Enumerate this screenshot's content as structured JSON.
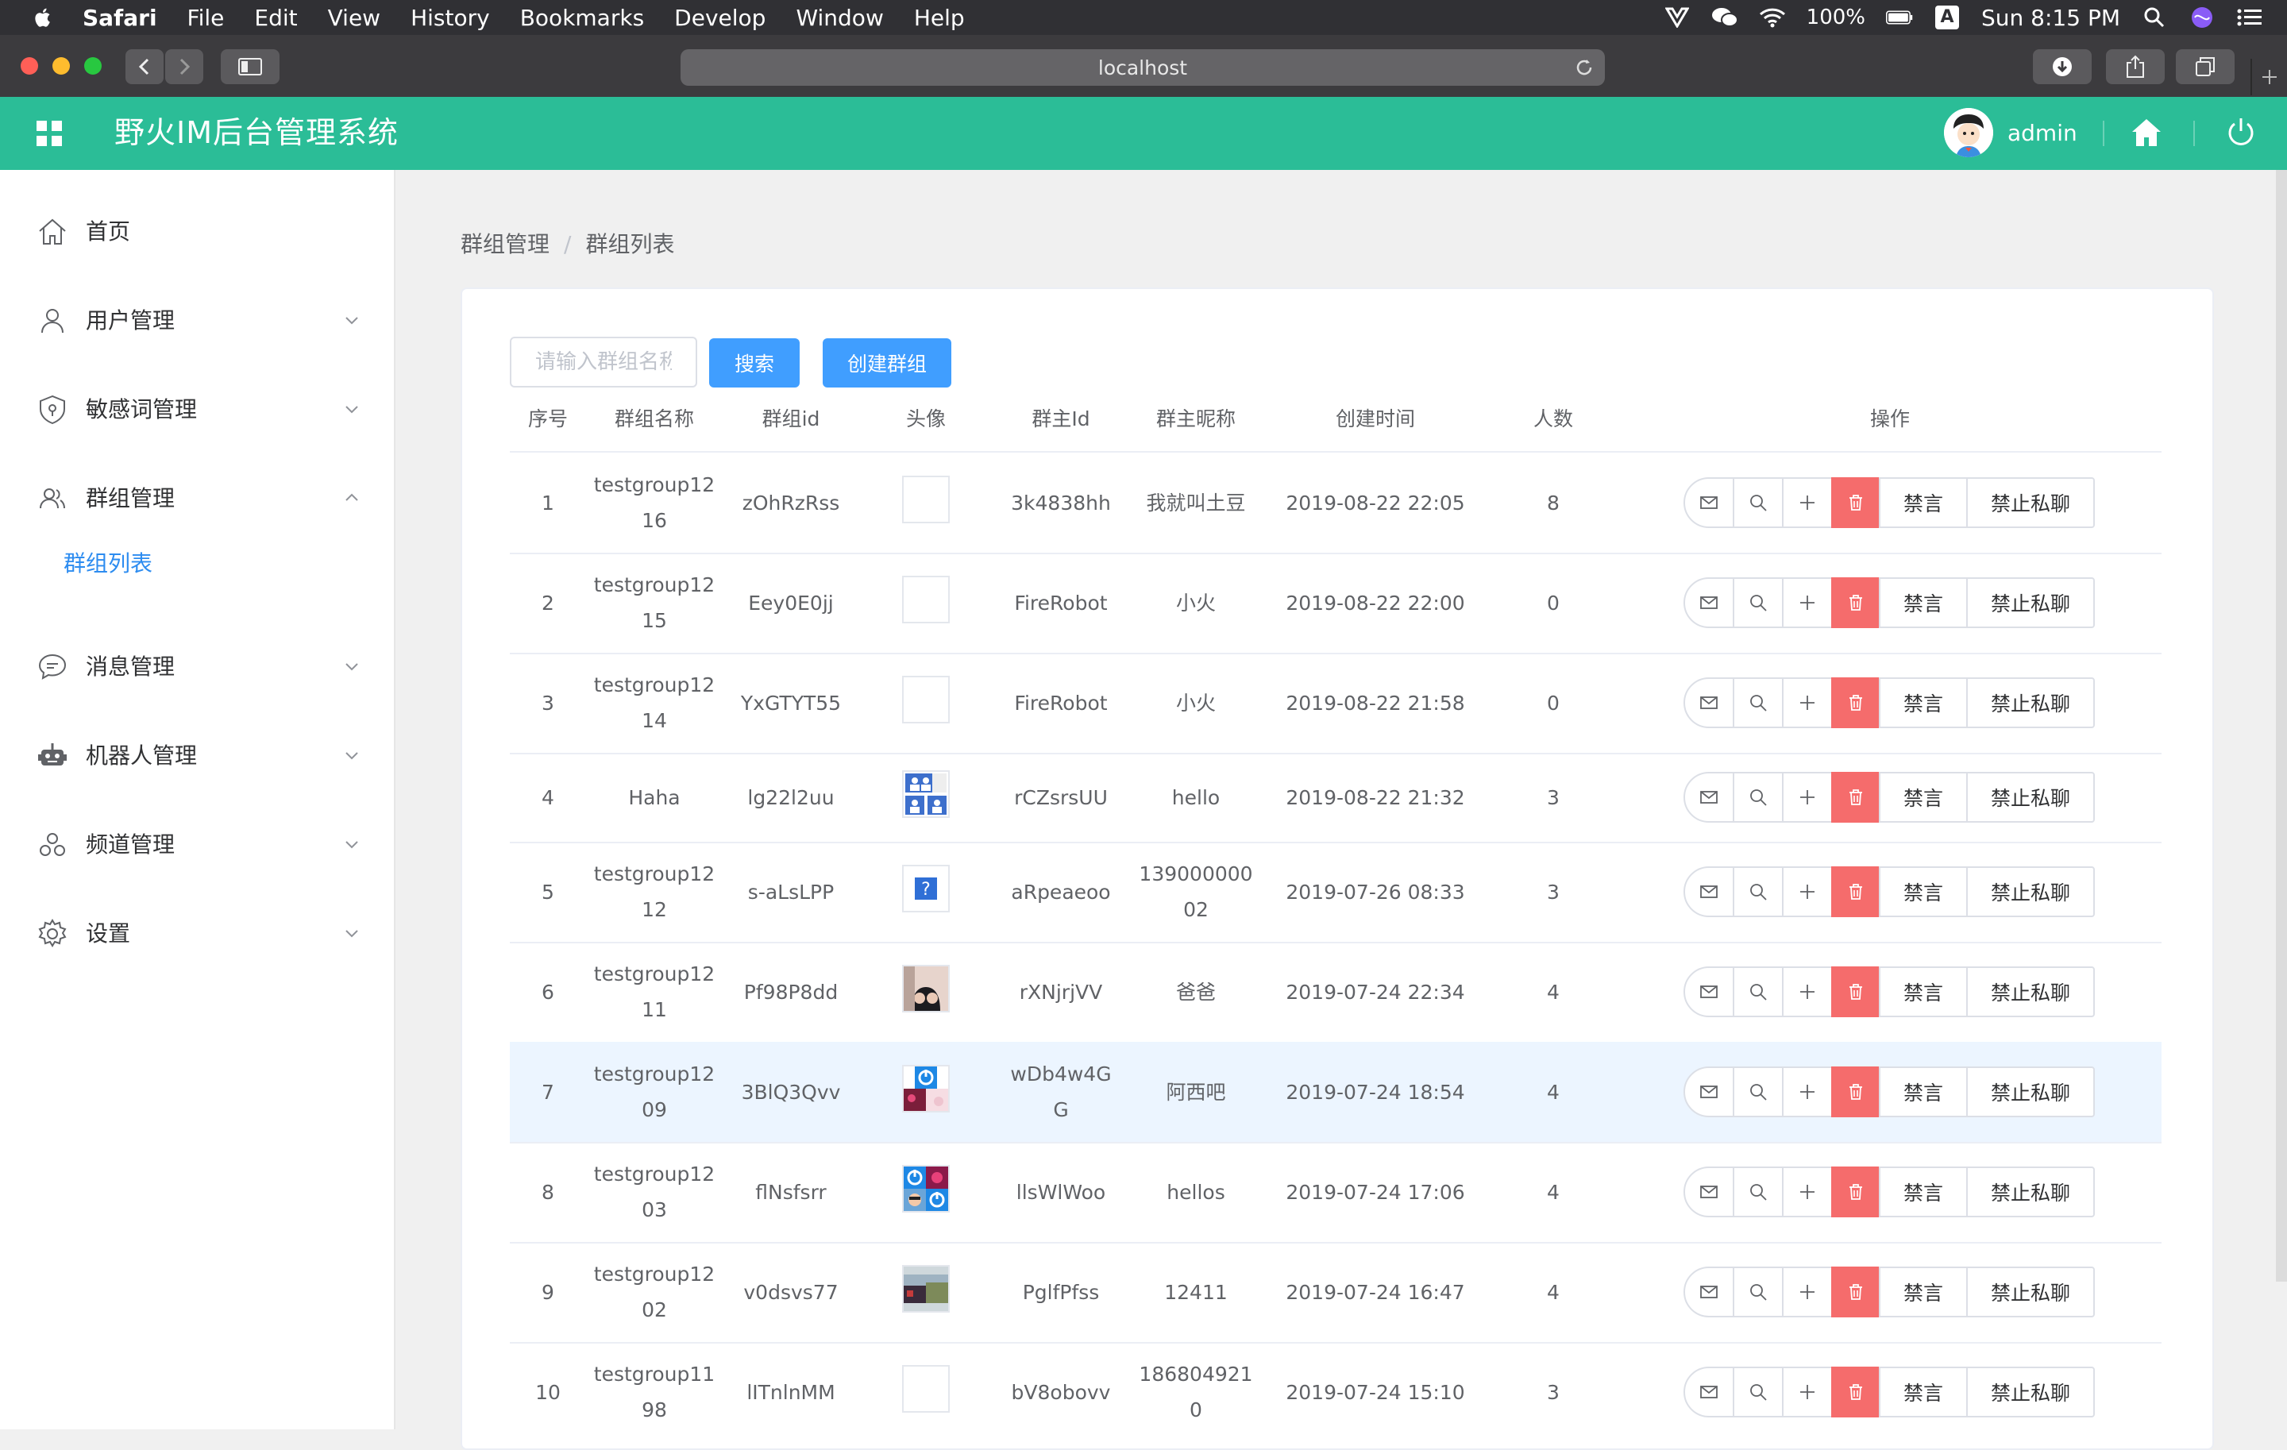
{
  "menubar": {
    "app": "Safari",
    "items": [
      "File",
      "Edit",
      "View",
      "History",
      "Bookmarks",
      "Develop",
      "Window",
      "Help"
    ],
    "battery": "100%",
    "input_source": "A",
    "clock": "Sun 8:15 PM"
  },
  "browser": {
    "url": "localhost"
  },
  "header": {
    "title": "野火IM后台管理系统",
    "user": "admin"
  },
  "sidebar": {
    "items": [
      {
        "label": "首页",
        "icon": "home-icon"
      },
      {
        "label": "用户管理",
        "icon": "user-icon"
      },
      {
        "label": "敏感词管理",
        "icon": "shield-icon"
      },
      {
        "label": "群组管理",
        "icon": "group-icon"
      },
      {
        "label": "消息管理",
        "icon": "chat-icon"
      },
      {
        "label": "机器人管理",
        "icon": "robot-icon"
      },
      {
        "label": "频道管理",
        "icon": "channel-icon"
      },
      {
        "label": "设置",
        "icon": "gear-icon"
      }
    ],
    "sub_active": "群组列表"
  },
  "breadcrumb": [
    "群组管理",
    "群组列表"
  ],
  "toolbar": {
    "search_placeholder": "请输入群组名称",
    "search_label": "搜索",
    "create_label": "创建群组"
  },
  "table": {
    "headers": [
      "序号",
      "群组名称",
      "群组id",
      "头像",
      "群主Id",
      "群主昵称",
      "创建时间",
      "人数",
      "操作"
    ],
    "op_labels": {
      "mute": "禁言",
      "no_private": "禁止私聊"
    },
    "rows": [
      {
        "no": "1",
        "name": [
          "testgroup12",
          "16"
        ],
        "gid": "zOhRzRss",
        "owner": [
          "3k4838hh"
        ],
        "nick": [
          "我就叫土豆"
        ],
        "time": "2019-08-22 22:05",
        "count": "8",
        "avatar": "blank"
      },
      {
        "no": "2",
        "name": [
          "testgroup12",
          "15"
        ],
        "gid": "Eey0E0jj",
        "owner": [
          "FireRobot"
        ],
        "nick": [
          "小火"
        ],
        "time": "2019-08-22 22:00",
        "count": "0",
        "avatar": "blank"
      },
      {
        "no": "3",
        "name": [
          "testgroup12",
          "14"
        ],
        "gid": "YxGTYT55",
        "owner": [
          "FireRobot"
        ],
        "nick": [
          "小火"
        ],
        "time": "2019-08-22 21:58",
        "count": "0",
        "avatar": "blank"
      },
      {
        "no": "4",
        "name": [
          "Haha"
        ],
        "gid": "lg22l2uu",
        "owner": [
          "rCZsrsUU"
        ],
        "nick": [
          "hello"
        ],
        "time": "2019-08-22 21:32",
        "count": "3",
        "avatar": "users"
      },
      {
        "no": "5",
        "name": [
          "testgroup12",
          "12"
        ],
        "gid": "s-aLsLPP",
        "owner": [
          "aRpeaeoo"
        ],
        "nick": [
          "139000000",
          "02"
        ],
        "time": "2019-07-26 08:33",
        "count": "3",
        "avatar": "question"
      },
      {
        "no": "6",
        "name": [
          "testgroup12",
          "11"
        ],
        "gid": "Pf98P8dd",
        "owner": [
          "rXNjrjVV"
        ],
        "nick": [
          "爸爸"
        ],
        "time": "2019-07-24 22:34",
        "count": "4",
        "avatar": "photo"
      },
      {
        "no": "7",
        "name": [
          "testgroup12",
          "09"
        ],
        "gid": "3BlQ3Qvv",
        "owner": [
          "wDb4w4G",
          "G"
        ],
        "nick": [
          "阿西吧"
        ],
        "time": "2019-07-24 18:54",
        "count": "4",
        "avatar": "mosaic",
        "highlight": true
      },
      {
        "no": "8",
        "name": [
          "testgroup12",
          "03"
        ],
        "gid": "flNsfsrr",
        "owner": [
          "llsWlWoo"
        ],
        "nick": [
          "hellos"
        ],
        "time": "2019-07-24 17:06",
        "count": "4",
        "avatar": "mosaic2"
      },
      {
        "no": "9",
        "name": [
          "testgroup12",
          "02"
        ],
        "gid": "v0dsvs77",
        "owner": [
          "PglfPfss"
        ],
        "nick": [
          "12411"
        ],
        "time": "2019-07-24 16:47",
        "count": "4",
        "avatar": "landscape"
      },
      {
        "no": "10",
        "name": [
          "testgroup11",
          "98"
        ],
        "gid": "lITnlnMM",
        "owner": [
          "bV8obovv"
        ],
        "nick": [
          "186804921",
          "0"
        ],
        "time": "2019-07-24 15:10",
        "count": "3",
        "avatar": "blank"
      }
    ]
  },
  "colors": {
    "header": "#2bbd97",
    "primary": "#409eff",
    "danger": "#f56c6c",
    "active_link": "#2d8cf0",
    "row_highlight": "#ecf5ff"
  }
}
